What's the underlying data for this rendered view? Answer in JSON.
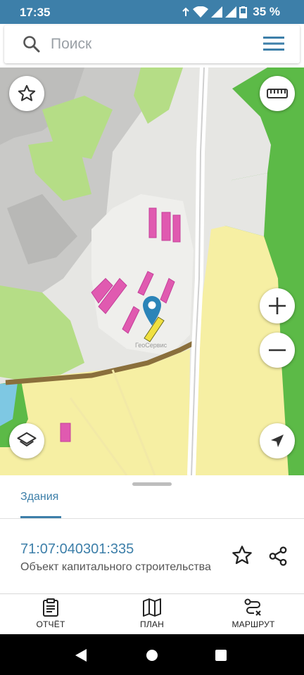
{
  "status_bar": {
    "time": "17:35",
    "battery": "35 %",
    "background_color": "#3d7fa9"
  },
  "search": {
    "placeholder": "Поиск",
    "icon": "search-icon",
    "menu_icon": "hamburger-menu-icon"
  },
  "map": {
    "watermark": "ГеоСервис",
    "controls": {
      "favorite": "star-icon",
      "ruler": "ruler-icon",
      "zoom_in": "plus-icon",
      "zoom_out": "minus-icon",
      "layers": "layers-icon",
      "locate": "navigation-arrow-icon"
    },
    "colors": {
      "forest": "#5cba47",
      "light_green": "#b5dd86",
      "yellow_zone": "#f8f0a0",
      "grey_zone": "#c8c8c8",
      "buildings": "#e05ab0",
      "selected_building": "#f0e040",
      "pin": "#2b84b8"
    }
  },
  "sheet": {
    "tab_label": "Здания",
    "cadastral_number": "71:07:040301:335",
    "description": "Объект капитального строительства",
    "actions": {
      "favorite": "star-outline-icon",
      "share": "share-icon"
    }
  },
  "bottom_nav": {
    "items": [
      {
        "label": "ОТЧЁТ",
        "icon": "clipboard-report-icon"
      },
      {
        "label": "ПЛАН",
        "icon": "map-plan-icon"
      },
      {
        "label": "МАРШРУТ",
        "icon": "route-icon"
      }
    ]
  },
  "system_nav": {
    "back": "back-triangle-icon",
    "home": "home-circle-icon",
    "recents": "recents-square-icon"
  }
}
